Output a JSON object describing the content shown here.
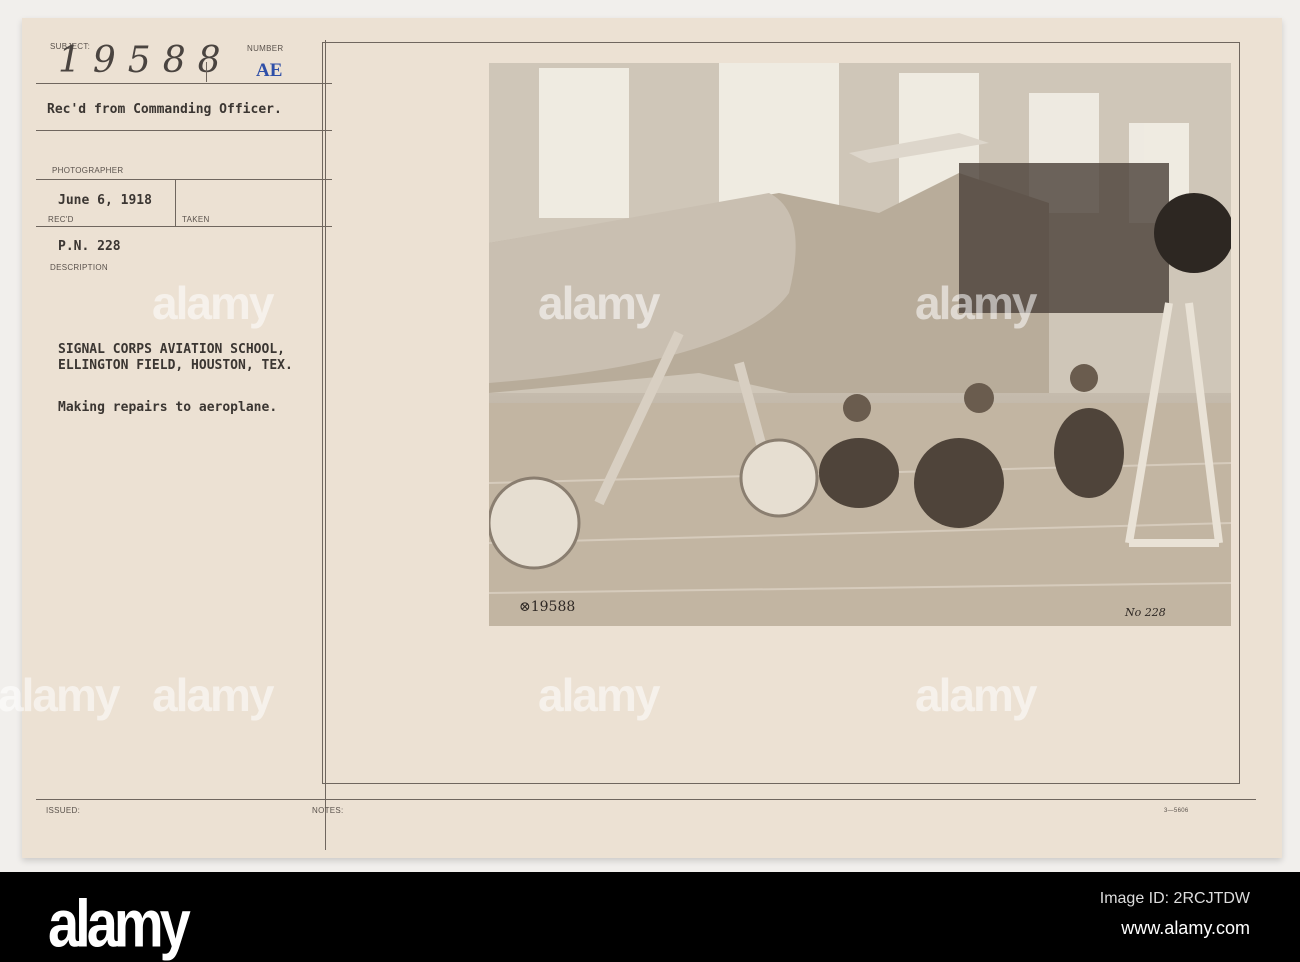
{
  "card": {
    "subject_label": "SUBJECT:",
    "subject_number": "19588",
    "number_label": "NUMBER",
    "number_stamp": "AE",
    "received_from": "Rec'd from Commanding Officer.",
    "photographer_label": "PHOTOGRAPHER",
    "date_received": "June 6, 1918",
    "recd_label": "REC'D",
    "taken_label": "TAKEN",
    "pn": "P.N. 228",
    "description_label": "DESCRIPTION",
    "description_line1": "SIGNAL CORPS AVIATION SCHOOL,",
    "description_line2": "ELLINGTON FIELD, HOUSTON, TEX.",
    "caption": "Making repairs to aeroplane.",
    "issued_label": "ISSUED:",
    "notes_label": "NOTES:",
    "form_number": "3—5606"
  },
  "photo": {
    "negative_number": "⊗19588",
    "plate_number": "No 228"
  },
  "watermark": {
    "text": "alamy",
    "image_id": "Image ID: 2RCJTDW",
    "url": "www.alamy.com"
  }
}
